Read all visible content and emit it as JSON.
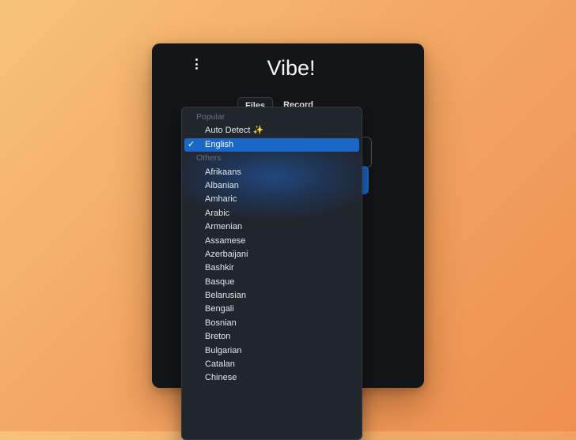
{
  "app": {
    "title": "Vibe!",
    "tabs": [
      "Files",
      "Record"
    ]
  },
  "language_dropdown": {
    "selected": "English",
    "popular_label": "Popular",
    "others_label": "Others",
    "popular": [
      "Auto Detect ✨",
      "English"
    ],
    "others": [
      "Afrikaans",
      "Albanian",
      "Amharic",
      "Arabic",
      "Armenian",
      "Assamese",
      "Azerbaijani",
      "Bashkir",
      "Basque",
      "Belarusian",
      "Bengali",
      "Bosnian",
      "Breton",
      "Bulgarian",
      "Catalan",
      "Chinese"
    ]
  },
  "icons": {
    "menu": "vertical-dots-icon",
    "check": "checkmark-icon"
  },
  "colors": {
    "accent": "#1b67c9",
    "window_bg": "#131519",
    "dropdown_bg": "#21252c"
  }
}
